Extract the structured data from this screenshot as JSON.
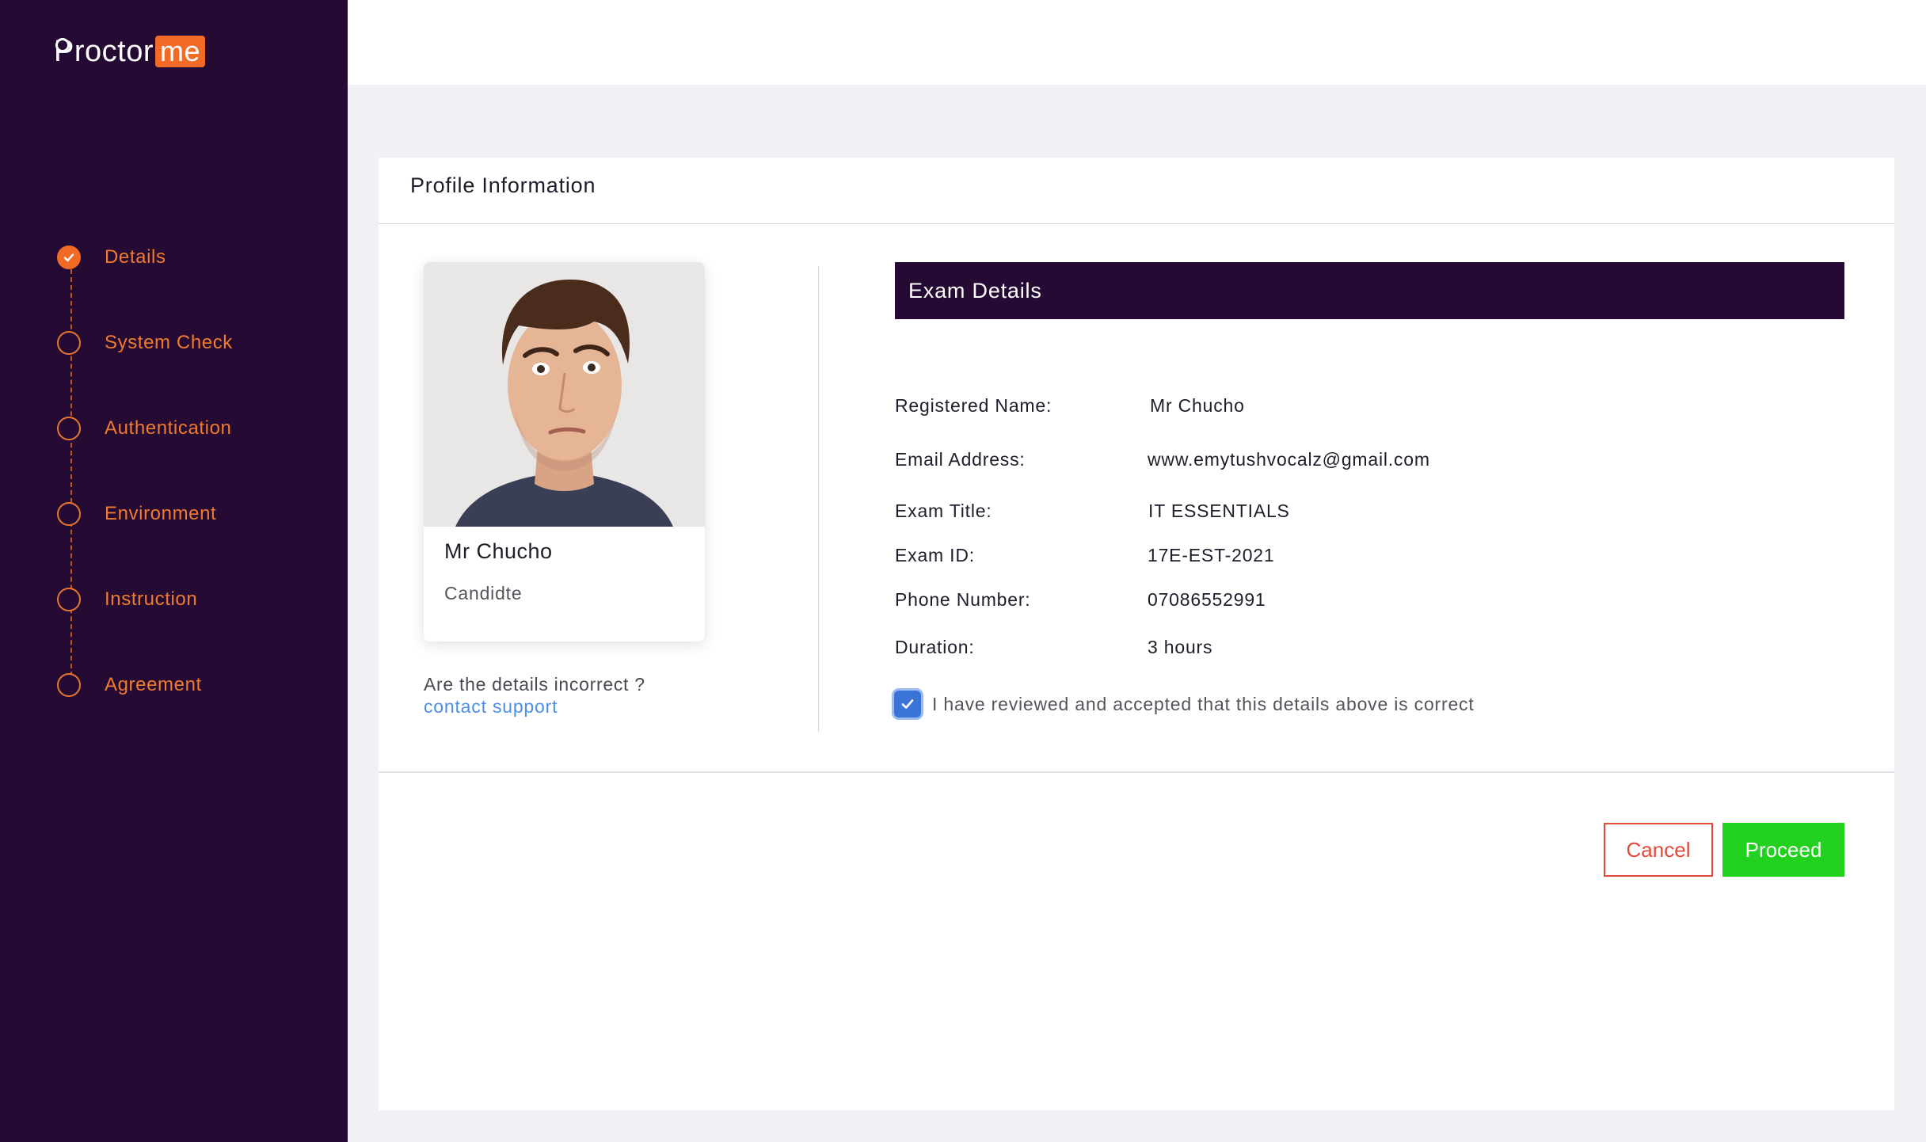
{
  "brand": {
    "logo_text": "Proctor",
    "logo_badge": "me",
    "accent_color": "#f16b26",
    "sidebar_color": "#250b33"
  },
  "steps": [
    {
      "label": "Details",
      "completed": true
    },
    {
      "label": "System Check",
      "completed": false
    },
    {
      "label": "Authentication",
      "completed": false
    },
    {
      "label": "Environment",
      "completed": false
    },
    {
      "label": "Instruction",
      "completed": false
    },
    {
      "label": "Agreement",
      "completed": false
    }
  ],
  "card": {
    "title": "Profile Information"
  },
  "profile": {
    "name": "Mr Chucho",
    "role": "Candidte",
    "incorrect_prompt": "Are the details incorrect ?",
    "support_link": "contact support"
  },
  "exam": {
    "header": "Exam Details",
    "rows": [
      {
        "label": "Registered Name:",
        "value": "Mr Chucho"
      },
      {
        "label": "Email Address:",
        "value": "www.emytushvocalz@gmail.com"
      },
      {
        "label": "Exam Title:",
        "value": "IT ESSENTIALS"
      },
      {
        "label": "Exam ID:",
        "value": "17E-EST-2021"
      },
      {
        "label": "Phone Number:",
        "value": "07086552991"
      },
      {
        "label": "Duration:",
        "value": "3 hours"
      }
    ],
    "agreement_text": "I have reviewed and accepted that this details above is correct",
    "agreement_checked": true
  },
  "actions": {
    "cancel_label": "Cancel",
    "proceed_label": "Proceed"
  }
}
